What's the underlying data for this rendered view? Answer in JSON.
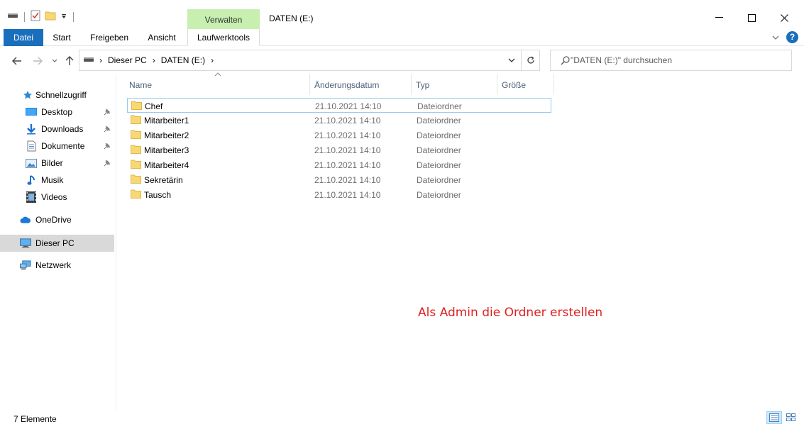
{
  "window": {
    "title": "DATEN (E:)",
    "context_group": "Verwalten",
    "minimize_glyph": "—",
    "maximize_glyph": "☐",
    "close_glyph": "✕"
  },
  "ribbon": {
    "tabs": [
      "Datei",
      "Start",
      "Freigeben",
      "Ansicht",
      "Laufwerktools"
    ],
    "accent": "#1a6fbd",
    "context_color": "#c6efb0",
    "help_glyph": "?"
  },
  "address": {
    "crumbs": [
      "Dieser PC",
      "DATEN (E:)"
    ],
    "separator": "›",
    "search_placeholder": "\"DATEN (E:)\" durchsuchen"
  },
  "sidebar": {
    "items": [
      {
        "label": "Schnellzugriff",
        "icon": "star-icon",
        "pinned": false
      },
      {
        "label": "Desktop",
        "icon": "desktop-icon",
        "pinned": true
      },
      {
        "label": "Downloads",
        "icon": "download-icon",
        "pinned": true
      },
      {
        "label": "Dokumente",
        "icon": "document-icon",
        "pinned": true
      },
      {
        "label": "Bilder",
        "icon": "pictures-icon",
        "pinned": true
      },
      {
        "label": "Musik",
        "icon": "music-icon",
        "pinned": false
      },
      {
        "label": "Videos",
        "icon": "video-icon",
        "pinned": false
      },
      {
        "label": "OneDrive",
        "icon": "cloud-icon",
        "pinned": false
      },
      {
        "label": "Dieser PC",
        "icon": "computer-icon",
        "pinned": false,
        "selected": true
      },
      {
        "label": "Netzwerk",
        "icon": "network-icon",
        "pinned": false
      }
    ]
  },
  "columns": [
    "Name",
    "Änderungsdatum",
    "Typ",
    "Größe"
  ],
  "files": [
    {
      "name": "Chef",
      "date": "21.10.2021 14:10",
      "type": "Dateiordner"
    },
    {
      "name": "Mitarbeiter1",
      "date": "21.10.2021 14:10",
      "type": "Dateiordner"
    },
    {
      "name": "Mitarbeiter2",
      "date": "21.10.2021 14:10",
      "type": "Dateiordner"
    },
    {
      "name": "Mitarbeiter3",
      "date": "21.10.2021 14:10",
      "type": "Dateiordner"
    },
    {
      "name": "Mitarbeiter4",
      "date": "21.10.2021 14:10",
      "type": "Dateiordner"
    },
    {
      "name": "Sekretärin",
      "date": "21.10.2021 14:10",
      "type": "Dateiordner"
    },
    {
      "name": "Tausch",
      "date": "21.10.2021 14:10",
      "type": "Dateiordner"
    }
  ],
  "annotation": "Als Admin die Ordner erstellen",
  "annotation_color": "#e02020",
  "status": {
    "count": "7 Elemente"
  }
}
